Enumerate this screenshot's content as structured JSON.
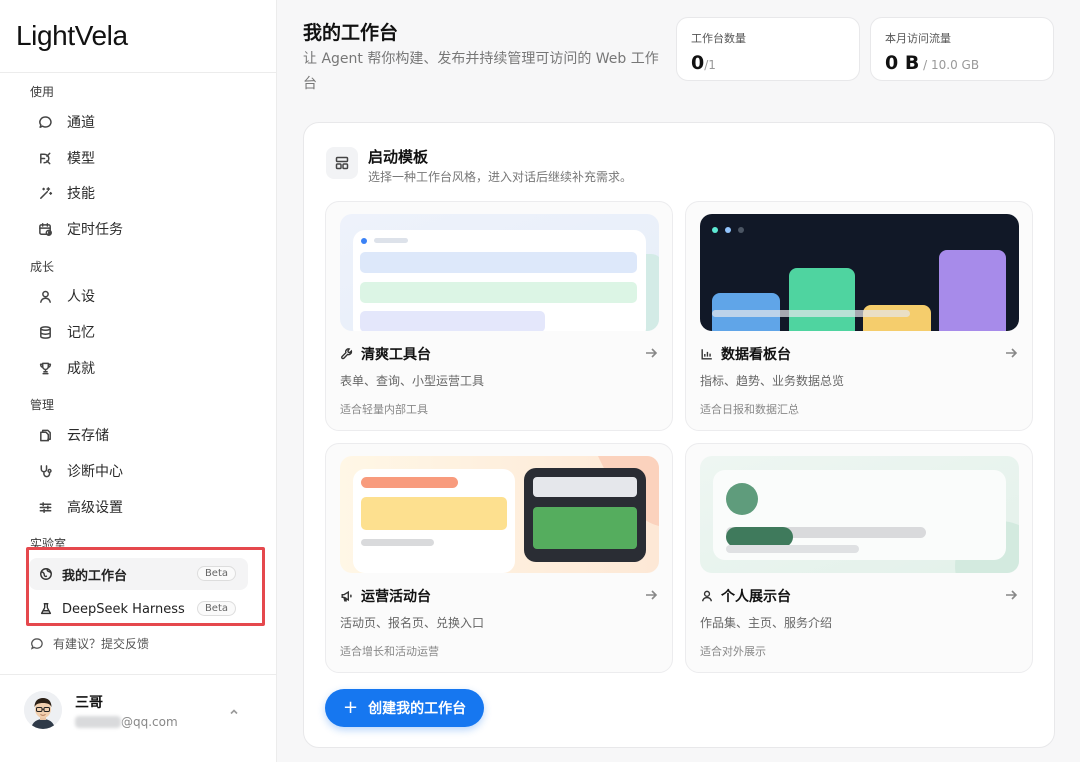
{
  "app": {
    "logo": "LightVela"
  },
  "sidebar": {
    "sections": {
      "use": "使用",
      "grow": "成长",
      "manage": "管理",
      "lab": "实验室"
    },
    "use_items": [
      {
        "label": "通道",
        "icon": "chat-bubble-icon"
      },
      {
        "label": "模型",
        "icon": "model-icon"
      },
      {
        "label": "技能",
        "icon": "magic-wand-icon"
      },
      {
        "label": "定时任务",
        "icon": "calendar-clock-icon"
      }
    ],
    "grow_items": [
      {
        "label": "人设",
        "icon": "person-icon"
      },
      {
        "label": "记忆",
        "icon": "database-icon"
      },
      {
        "label": "成就",
        "icon": "trophy-icon"
      }
    ],
    "manage_items": [
      {
        "label": "云存储",
        "icon": "files-icon"
      },
      {
        "label": "诊断中心",
        "icon": "stethoscope-icon"
      },
      {
        "label": "高级设置",
        "icon": "sliders-icon"
      }
    ],
    "lab_items": [
      {
        "label": "我的工作台",
        "badge": "Beta",
        "icon": "globe-icon",
        "active": true
      },
      {
        "label": "DeepSeek Harness",
        "badge": "Beta",
        "icon": "flask-icon",
        "active": false
      }
    ],
    "feedback": "有建议？提交反馈",
    "user": {
      "name": "三哥",
      "email_suffix": "@qq.com"
    }
  },
  "header": {
    "title": "我的工作台",
    "description": "让 Agent 帮你构建、发布并持续管理可访问的 Web 工作台"
  },
  "stats": [
    {
      "label": "工作台数量",
      "value": "0",
      "suffix": "/1"
    },
    {
      "label": "本月访问流量",
      "value": "0 B",
      "suffix": " / 10.0 GB"
    }
  ],
  "templates": {
    "title": "启动模板",
    "subtitle": "选择一种工作台风格，进入对话后继续补充需求。",
    "cards": [
      {
        "title": "清爽工具台",
        "desc": "表单、查询、小型运营工具",
        "note": "适合轻量内部工具",
        "icon": "wrench-icon"
      },
      {
        "title": "数据看板台",
        "desc": "指标、趋势、业务数据总览",
        "note": "适合日报和数据汇总",
        "icon": "bar-chart-icon"
      },
      {
        "title": "运营活动台",
        "desc": "活动页、报名页、兑换入口",
        "note": "适合增长和活动运营",
        "icon": "megaphone-icon"
      },
      {
        "title": "个人展示台",
        "desc": "作品集、主页、服务介绍",
        "note": "适合对外展示",
        "icon": "person-icon"
      }
    ]
  },
  "actions": {
    "create": "创建我的工作台",
    "create_icon": "+"
  },
  "colors": {
    "primary": "#1677f0",
    "highlight": "#e5484d"
  }
}
